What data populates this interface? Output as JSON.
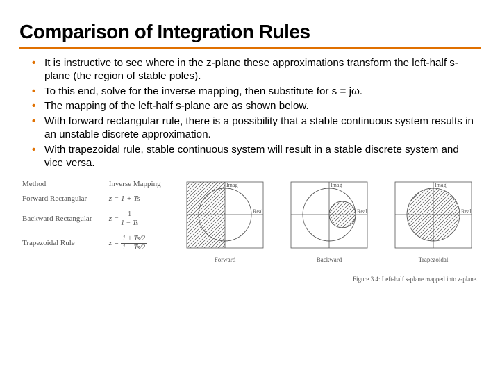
{
  "title": "Comparison of Integration Rules",
  "bullets": [
    "It is instructive to see where in the z-plane these approximations transform the left-half s-plane (the region of stable poles).",
    "To this end, solve for the inverse mapping, then substitute for s = jω.",
    "The mapping of the left-half s-plane are as shown below.",
    "With forward rectangular rule, there is a possibility that a stable continuous system results in an unstable discrete approximation.",
    "With trapezoidal rule, stable continuous system will result in  a stable discrete system and vice versa."
  ],
  "table": {
    "headers": [
      "Method",
      "Inverse Mapping"
    ],
    "rows": [
      {
        "method": "Forward Rectangular",
        "mapping_plain": "z = 1 + Ts"
      },
      {
        "method": "Backward Rectangular",
        "mapping_num": "1",
        "mapping_den": "1 − Ts"
      },
      {
        "method": "Trapezoidal Rule",
        "mapping_num": "1 + Ts/2",
        "mapping_den": "1 − Ts/2"
      }
    ]
  },
  "plots": {
    "axis_x": "Real",
    "axis_y": "Imag",
    "items": [
      {
        "label": "Forward"
      },
      {
        "label": "Backward"
      },
      {
        "label": "Trapezoidal"
      }
    ]
  },
  "figure_caption": "Figure 3.4: Left-half s-plane mapped into z-plane."
}
